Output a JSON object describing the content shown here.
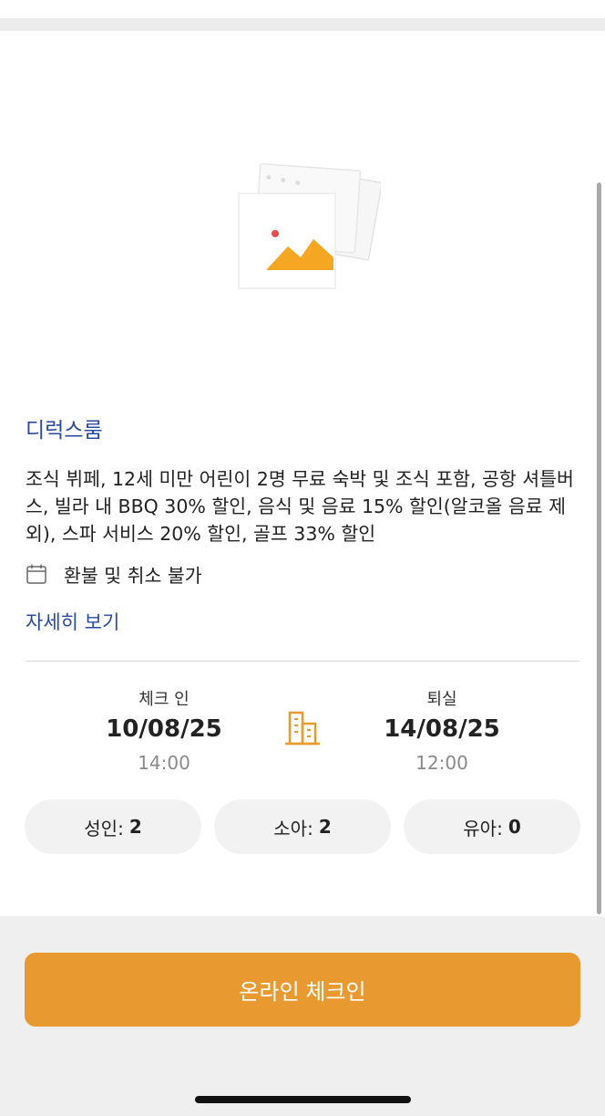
{
  "room": {
    "title": "디럭스룸",
    "description": "조식 뷔페, 12세 미만 어린이 2명 무료 숙박 및 조식 포함, 공항 셔틀버스, 빌라 내 BBQ 30% 할인, 음식 및 음료 15% 할인(알코올 음료 제외), 스파 서비스 20% 할인, 골프 33% 할인",
    "refund_policy": "환불 및 취소 불가",
    "details_link": "자세히 보기"
  },
  "stay": {
    "checkin_label": "체크 인",
    "checkin_date": "10/08/25",
    "checkin_time": "14:00",
    "checkout_label": "퇴실",
    "checkout_date": "14/08/25",
    "checkout_time": "12:00"
  },
  "guests": {
    "adult_label": "성인:",
    "adult_count": "2",
    "child_label": "소아:",
    "child_count": "2",
    "infant_label": "유아:",
    "infant_count": "0"
  },
  "actions": {
    "online_checkin_label": "온라인 체크인"
  },
  "icons": {
    "image_placeholder": "image-placeholder-icon",
    "calendar": "calendar-icon",
    "building": "building-icon"
  },
  "colors": {
    "accent_orange": "#e8992f",
    "link_blue": "#2b4aa0"
  }
}
